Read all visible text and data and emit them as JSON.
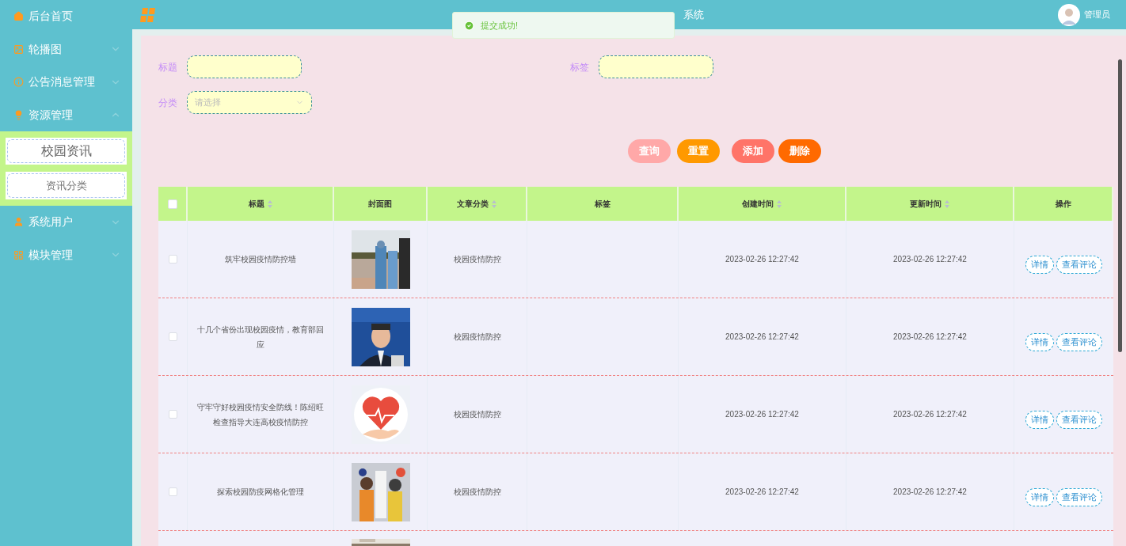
{
  "sidebar": {
    "items": [
      {
        "label": "后台首页"
      },
      {
        "label": "轮播图",
        "expanded": false,
        "has_children": true
      },
      {
        "label": "公告消息管理",
        "expanded": false,
        "has_children": true
      },
      {
        "label": "资源管理",
        "expanded": true,
        "has_children": true,
        "children": [
          {
            "label": "校园资讯",
            "selected": true
          },
          {
            "label": "资讯分类",
            "selected": false
          }
        ]
      },
      {
        "label": "系统用户",
        "expanded": false,
        "has_children": true
      },
      {
        "label": "模块管理",
        "expanded": false,
        "has_children": true
      }
    ]
  },
  "header": {
    "title": "系统",
    "user": "管理员"
  },
  "toast": {
    "message": "提交成功!"
  },
  "filters": [
    {
      "label": "标题",
      "kind": "input"
    },
    {
      "label": "标签",
      "kind": "input"
    },
    {
      "label": "分类",
      "kind": "select",
      "placeholder": "请选择"
    }
  ],
  "buttons": [
    {
      "label": "查询",
      "color": "#ffa8a8"
    },
    {
      "label": "重置",
      "color": "#ff9900"
    },
    {
      "label": "添加",
      "color": "#ff7468"
    },
    {
      "label": "删除",
      "color": "#ff6a00"
    }
  ],
  "table": {
    "columns": [
      {
        "label": "标题",
        "sortable": true
      },
      {
        "label": "封面图",
        "sortable": false
      },
      {
        "label": "文章分类",
        "sortable": true
      },
      {
        "label": "标签",
        "sortable": false
      },
      {
        "label": "创建时间",
        "sortable": true
      },
      {
        "label": "更新时间",
        "sortable": true
      },
      {
        "label": "操作",
        "sortable": false
      }
    ],
    "all_checked": false,
    "rows": [
      {
        "kind": "full",
        "checked": false,
        "title": "筑牢校园疫情防控墙",
        "category": "校园疫情防控",
        "created": "2023-02-26 12:27:42",
        "updated": "2023-02-26 12:27:42",
        "actions": [
          "详情",
          "查看评论"
        ]
      },
      {
        "kind": "full",
        "checked": false,
        "title": "十几个省份出现校园疫情，教育部回应",
        "category": "校园疫情防控",
        "created": "2023-02-26 12:27:42",
        "updated": "2023-02-26 12:27:42",
        "actions": [
          "详情",
          "查看评论"
        ]
      },
      {
        "kind": "full",
        "checked": false,
        "title": "守牢守好校园疫情安全防线！陈绍旺检查指导大连高校疫情防控",
        "category": "校园疫情防控",
        "created": "2023-02-26 12:27:42",
        "updated": "2023-02-26 12:27:42",
        "actions": [
          "详情",
          "查看评论"
        ]
      },
      {
        "kind": "full",
        "checked": false,
        "title": "探索校园防疫网格化管理",
        "category": "校园疫情防控",
        "created": "2023-02-26 12:27:42",
        "updated": "2023-02-26 12:27:42",
        "actions": [
          "详情",
          "查看评论"
        ]
      },
      {
        "kind": "cut"
      }
    ]
  }
}
